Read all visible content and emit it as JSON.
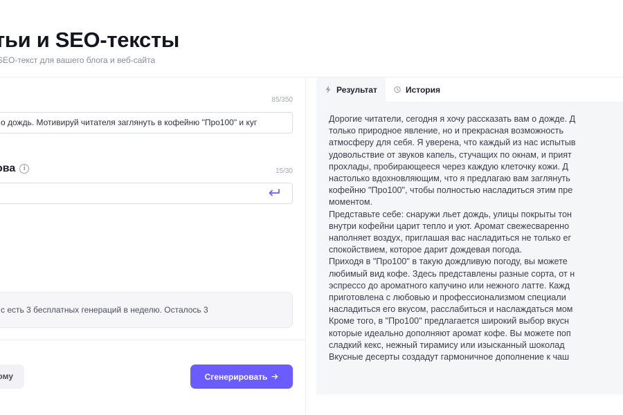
{
  "header": {
    "title": "тьи и SEO-тексты",
    "subtitle": "SEO-текст для вашего блога и веб-сайта"
  },
  "form": {
    "topic_counter": "85/350",
    "topic_value": "о дождь. Мотивируй читателя заглянуть в кофейню \"Про100\" и куг",
    "keywords_label": "ова",
    "keywords_counter": "15/30",
    "keywords_value": "",
    "notice": "с есть 3 бесплатных генераций в неделю. Осталось 3",
    "secondary_button": "ому",
    "generate_button": "Сгенерировать"
  },
  "result_panel": {
    "tabs": [
      {
        "label": "Результат",
        "icon": "lightning-icon",
        "active": true
      },
      {
        "label": "История",
        "icon": "clock-icon",
        "active": false
      }
    ],
    "lines": [
      "Дорогие читатели, сегодня я хочу рассказать вам о дожде. Д",
      "только природное явление, но и прекрасная возможность",
      "атмосферу для себя. Я уверена, что каждый из нас испытыв",
      "удовольствие от звуков капель, стучащих по окнам, и прият",
      "прохлады, пробирающееся через каждую клеточку кожи. Д",
      "настолько вдохновляющим, что я предлагаю вам заглянуть",
      "кофейню \"Про100\", чтобы полностью насладиться этим пре",
      "моментом.",
      "Представьте себе: снаружи льет дождь, улицы покрыты тон",
      "внутри кофейни царит тепло и уют. Аромат свежесваренно",
      "наполняет воздух, приглашая вас насладиться не только ег",
      "спокойствием, которое дарит дождевая погода.",
      "Приходя в \"Про100\" в такую дождливую погоду, вы можете",
      "любимый вид кофе. Здесь представлены разные сорта, от н",
      "эспрессо до ароматного капучино или нежного латте. Кажд",
      "приготовлена с любовью и профессионализмом специали",
      "насладиться его вкусом, расслабиться и наслаждаться мом",
      "Кроме того, в \"Про100\" предлагается широкий выбор вкусн",
      "которые идеально дополняют аромат кофе. Вы можете поп",
      "сладкий кекс, нежный тирамису или изысканный шоколад",
      "Вкусные десерты создадут гармоничное дополнение к чаш"
    ]
  },
  "colors": {
    "accent": "#6b5cff",
    "panel_bg": "#f5f6f8",
    "border": "#dcdde3"
  }
}
